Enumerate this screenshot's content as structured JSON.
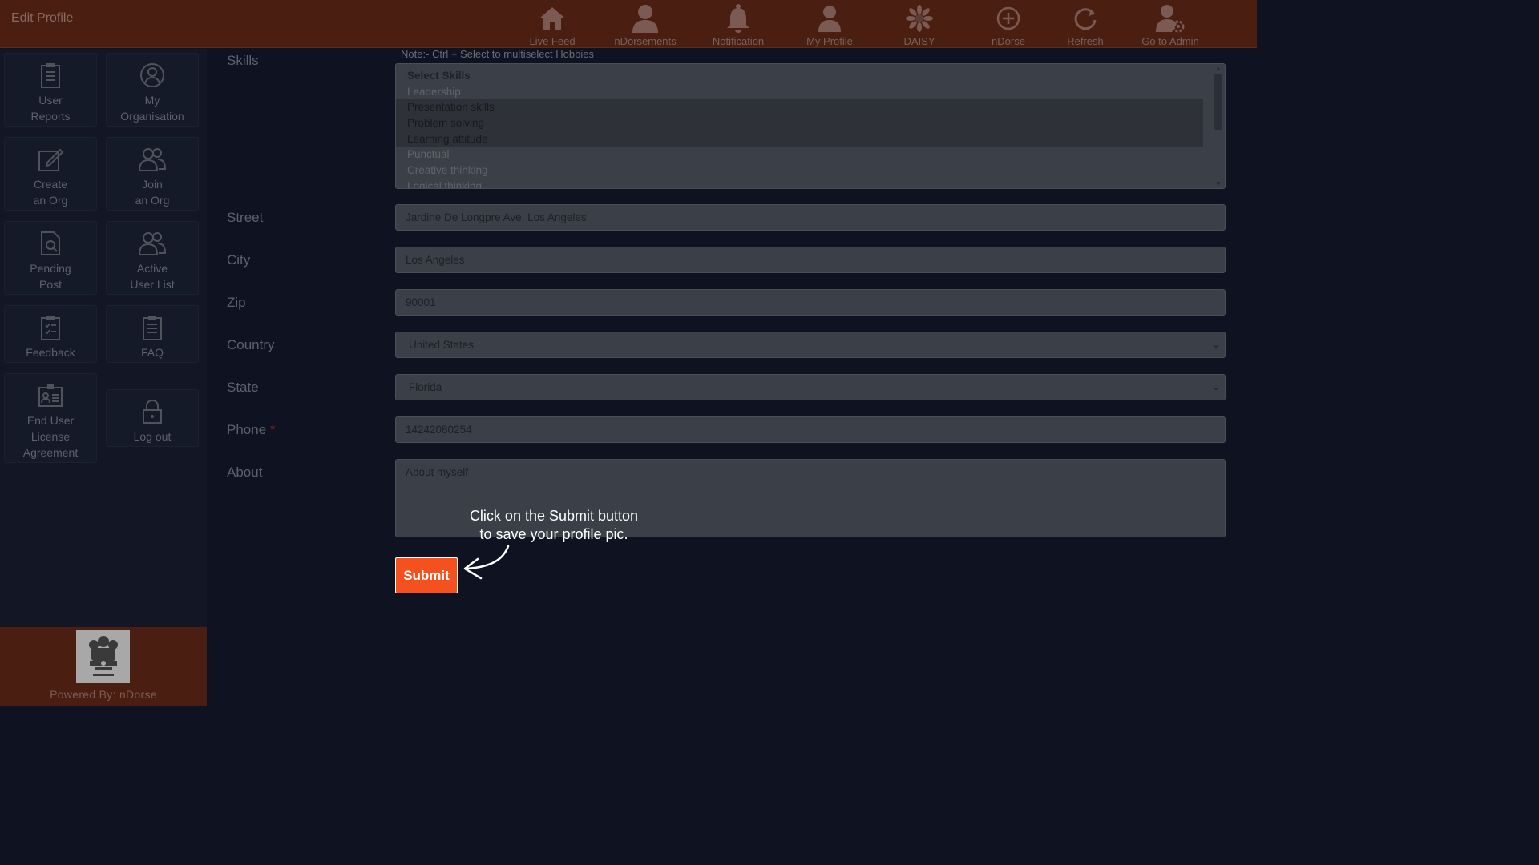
{
  "header": {
    "title": "Edit Profile",
    "nav": [
      {
        "label": "Live Feed",
        "icon": "home-icon"
      },
      {
        "label": "nDorsements",
        "icon": "user-icon"
      },
      {
        "label": "Notification",
        "icon": "bell-icon"
      },
      {
        "label": "My Profile",
        "icon": "profile-icon"
      },
      {
        "label": "DAISY",
        "icon": "daisy-icon"
      },
      {
        "label": "nDorse",
        "icon": "plus-circle-icon"
      },
      {
        "label": "Refresh",
        "icon": "refresh-icon"
      },
      {
        "label": "Go to Admin",
        "icon": "admin-gear-icon"
      }
    ]
  },
  "sidebar": {
    "tiles": [
      {
        "label": "User\nReports",
        "icon": "clipboard-icon"
      },
      {
        "label": "My\nOrganisation",
        "icon": "organisation-icon"
      },
      {
        "label": "Create\nan Org",
        "icon": "edit-icon"
      },
      {
        "label": "Join\nan Org",
        "icon": "users-icon"
      },
      {
        "label": "Pending\nPost",
        "icon": "document-search-icon"
      },
      {
        "label": "Active\nUser List",
        "icon": "users-icon"
      },
      {
        "label": "Feedback",
        "icon": "feedback-icon"
      },
      {
        "label": "FAQ",
        "icon": "clipboard-icon"
      },
      {
        "label": "End User\nLicense\nAgreement",
        "icon": "id-card-icon"
      },
      {
        "label": "Log out",
        "icon": "lock-icon"
      }
    ],
    "powered_by": "Powered By: nDorse",
    "emblem_icon": "emblem-icon"
  },
  "form": {
    "skills": {
      "label": "Skills",
      "note": "Note:- Ctrl + Select to multiselect Hobbies",
      "header": "Select Skills",
      "options": [
        {
          "text": "Leadership",
          "selected": false
        },
        {
          "text": "Presentation skills",
          "selected": true
        },
        {
          "text": "Problem solving",
          "selected": true
        },
        {
          "text": "Learning attitude",
          "selected": true
        },
        {
          "text": "Punctual",
          "selected": false
        },
        {
          "text": "Creative thinking",
          "selected": false
        },
        {
          "text": "Logical thinking",
          "selected": false
        }
      ]
    },
    "street": {
      "label": "Street",
      "value": "Jardine  De Longpre Ave, Los Angeles"
    },
    "city": {
      "label": "City",
      "value": "Los Angeles"
    },
    "zip": {
      "label": "Zip",
      "value": "90001"
    },
    "country": {
      "label": "Country",
      "value": "United States"
    },
    "state": {
      "label": "State",
      "value": "Florida"
    },
    "phone": {
      "label": "Phone",
      "required_mark": "*",
      "value": "14242080254"
    },
    "about": {
      "label": "About",
      "value": "About myself"
    },
    "submit_label": "Submit"
  },
  "tooltip": {
    "line1": "Click on the Submit button",
    "line2": "to save your profile pic."
  },
  "colors": {
    "topbar": "#4a1f12",
    "accent": "#f4511e",
    "background": "#0f1220"
  }
}
